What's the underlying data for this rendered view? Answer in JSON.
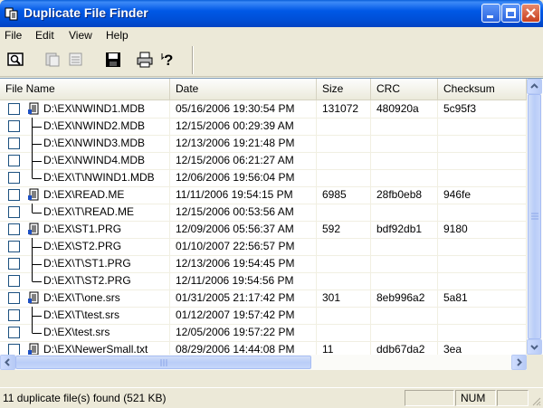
{
  "window": {
    "title": "Duplicate File Finder"
  },
  "menu": [
    "File",
    "Edit",
    "View",
    "Help"
  ],
  "toolbar": [
    "preview-icon",
    "properties-icon",
    "list-icon",
    "save-icon",
    "print-icon",
    "help-icon"
  ],
  "columns": [
    "File Name",
    "Date",
    "Size",
    "CRC",
    "Checksum"
  ],
  "rows": [
    {
      "name": "D:\\EX\\NWIND1.MDB",
      "date": "05/16/2006 19:30:54 PM",
      "size": "131072",
      "crc": "480920a",
      "checksum": "5c95f3",
      "tree": "head"
    },
    {
      "name": "D:\\EX\\NWIND2.MDB",
      "date": "12/15/2006 00:29:39 AM",
      "size": "",
      "crc": "",
      "checksum": "",
      "tree": "mid"
    },
    {
      "name": "D:\\EX\\NWIND3.MDB",
      "date": "12/13/2006 19:21:48 PM",
      "size": "",
      "crc": "",
      "checksum": "",
      "tree": "mid"
    },
    {
      "name": "D:\\EX\\NWIND4.MDB",
      "date": "12/15/2006 06:21:27 AM",
      "size": "",
      "crc": "",
      "checksum": "",
      "tree": "mid"
    },
    {
      "name": "D:\\EX\\T\\NWIND1.MDB",
      "date": "12/06/2006 19:56:04 PM",
      "size": "",
      "crc": "",
      "checksum": "",
      "tree": "last"
    },
    {
      "name": "D:\\EX\\READ.ME",
      "date": "11/11/2006 19:54:15 PM",
      "size": "6985",
      "crc": "28fb0eb8",
      "checksum": "946fe",
      "tree": "head"
    },
    {
      "name": "D:\\EX\\T\\READ.ME",
      "date": "12/15/2006 00:53:56 AM",
      "size": "",
      "crc": "",
      "checksum": "",
      "tree": "last"
    },
    {
      "name": "D:\\EX\\ST1.PRG",
      "date": "12/09/2006 05:56:37 AM",
      "size": "592",
      "crc": "bdf92db1",
      "checksum": "9180",
      "tree": "head"
    },
    {
      "name": "D:\\EX\\ST2.PRG",
      "date": "01/10/2007 22:56:57 PM",
      "size": "",
      "crc": "",
      "checksum": "",
      "tree": "mid"
    },
    {
      "name": "D:\\EX\\T\\ST1.PRG",
      "date": "12/13/2006 19:54:45 PM",
      "size": "",
      "crc": "",
      "checksum": "",
      "tree": "mid"
    },
    {
      "name": "D:\\EX\\T\\ST2.PRG",
      "date": "12/11/2006 19:54:56 PM",
      "size": "",
      "crc": "",
      "checksum": "",
      "tree": "last"
    },
    {
      "name": "D:\\EX\\T\\one.srs",
      "date": "01/31/2005 21:17:42 PM",
      "size": "301",
      "crc": "8eb996a2",
      "checksum": "5a81",
      "tree": "head"
    },
    {
      "name": "D:\\EX\\T\\test.srs",
      "date": "01/12/2007 19:57:42 PM",
      "size": "",
      "crc": "",
      "checksum": "",
      "tree": "mid"
    },
    {
      "name": "D:\\EX\\test.srs",
      "date": "12/05/2006 19:57:22 PM",
      "size": "",
      "crc": "",
      "checksum": "",
      "tree": "last"
    },
    {
      "name": "D:\\EX\\NewerSmall.txt",
      "date": "08/29/2006 14:44:08 PM",
      "size": "11",
      "crc": "ddb67da2",
      "checksum": "3ea",
      "tree": "head"
    }
  ],
  "status": {
    "text": "11 duplicate file(s) found  (521 KB)",
    "num": "NUM"
  }
}
